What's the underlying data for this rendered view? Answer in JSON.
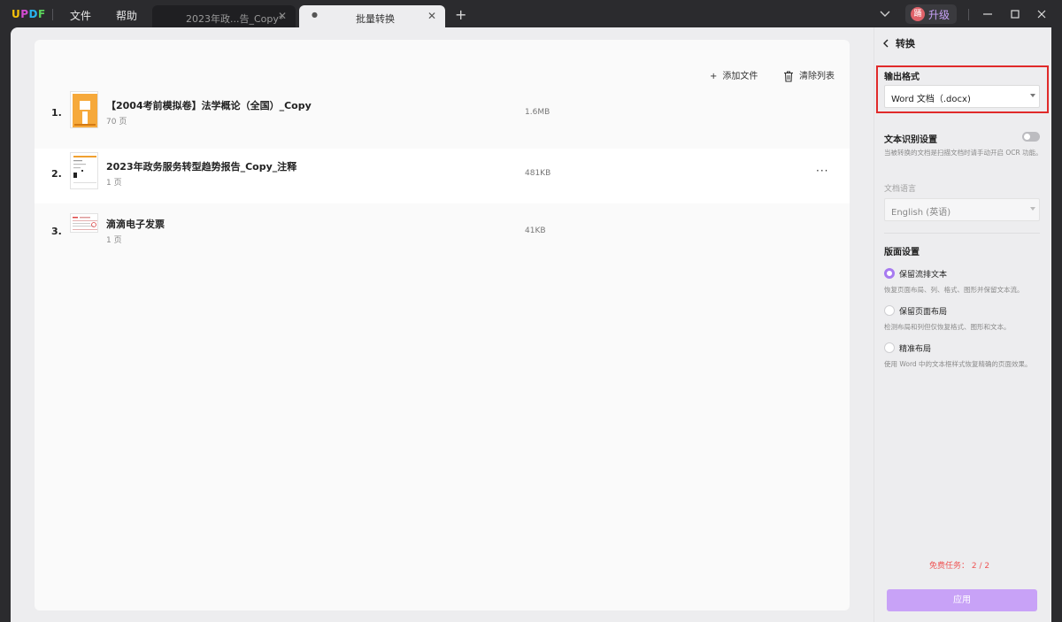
{
  "app": {
    "logo_letters": [
      "U",
      "P",
      "D",
      "F"
    ],
    "logo_colors": [
      "#f5c20a",
      "#d24bd2",
      "#28b4f0",
      "#5bd35b"
    ],
    "menu": [
      "文件",
      "帮助"
    ],
    "upgrade_avatar": "踊",
    "upgrade_label": "升级"
  },
  "tabs": [
    {
      "label": "2023年政...告_Copy*",
      "active": false
    },
    {
      "label": "批量转换",
      "active": true
    }
  ],
  "toolbar": {
    "add_file": "添加文件",
    "clear_list": "清除列表"
  },
  "files": [
    {
      "index": "1.",
      "name": "【2004考前模拟卷】法学概论（全国）_Copy",
      "pages": "70 页",
      "size": "1.6MB",
      "highlighted": false,
      "thumb": "orange-doc-icon"
    },
    {
      "index": "2.",
      "name": "2023年政务服务转型趋势报告_Copy_注释",
      "pages": "1 页",
      "size": "481KB",
      "highlighted": true,
      "thumb": "report-doc-icon",
      "more": "···"
    },
    {
      "index": "3.",
      "name": "滴滴电子发票",
      "pages": "1 页",
      "size": "41KB",
      "highlighted": false,
      "thumb": "invoice-doc-icon"
    }
  ],
  "sidebar": {
    "back_label": "转换",
    "output_format_title": "输出格式",
    "output_format_value": "Word 文档（.docx)",
    "ocr_title": "文本识别设置",
    "ocr_desc": "当被转换的文档是扫描文档时请手动开启 OCR 功能。",
    "ocr_enabled": false,
    "doc_lang_label": "文档语言",
    "doc_lang_value": "English (英语)",
    "layout_title": "版面设置",
    "layout_options": [
      {
        "label": "保留流排文本",
        "desc": "恢复页面布局、列、格式、图形并保留文本流。",
        "selected": true
      },
      {
        "label": "保留页面布局",
        "desc": "检测布局和列但仅恢复格式、图形和文本。",
        "selected": false
      },
      {
        "label": "精准布局",
        "desc": "使用 Word 中的文本框样式恢复精确的页面效果。",
        "selected": false
      }
    ],
    "free_tasks": "免费任务：  2 / 2",
    "apply_label": "应用"
  },
  "colors": {
    "accent": "#a77af0",
    "apply_bg": "#c8a2f7",
    "highlight_box": "#e02a2a",
    "free_tasks": "#e55555"
  }
}
